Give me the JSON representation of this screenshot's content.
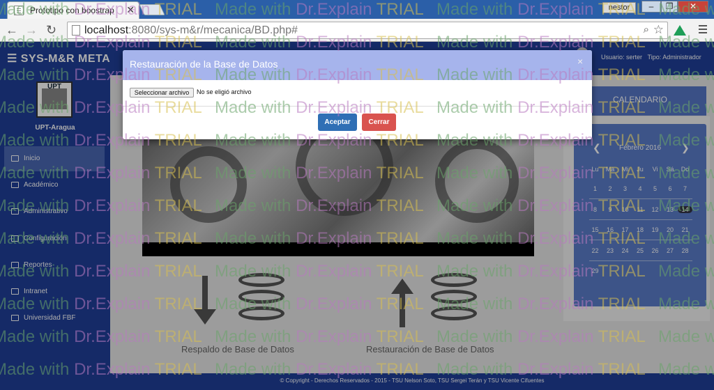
{
  "browser": {
    "tab_title": "Prototipo con boostrap",
    "tab_close": "✕",
    "profile": "nestor",
    "url_host": "localhost",
    "url_path": ":8080/sys-m&r/mecanica/BD.php#",
    "window_min": "–",
    "window_max": "❐",
    "window_close": "✕"
  },
  "app": {
    "brand": "☰  SYS-M&R  META",
    "user_label": "Usuario: serter",
    "role_label": "Tipo: Administrador",
    "logo_text": "UPT",
    "institution": "UPT-Aragua"
  },
  "sidebar": {
    "items": [
      {
        "label": "Inicio",
        "icon": "folder-open-icon"
      },
      {
        "label": "Académico",
        "icon": "book-icon"
      },
      {
        "label": "Administrativo",
        "icon": "monitor-icon"
      },
      {
        "label": "Configuración",
        "icon": "gears-icon"
      },
      {
        "label": "Reportes",
        "icon": "file-icon"
      },
      {
        "label": "Intranet",
        "icon": "sitemap-icon"
      },
      {
        "label": "Universidad FBF",
        "icon": "institution-icon"
      }
    ]
  },
  "main": {
    "backup_caption": "Respaldo de Base de Datos",
    "restore_caption": "Restauración de Base de Datos"
  },
  "calendar": {
    "title": "CALENDARIO",
    "month": "Febrero 2016",
    "prev": "❮",
    "next": "❯",
    "weekdays": [
      "Lu",
      "Ma",
      "Mi",
      "Ju",
      "Vi",
      "Sá",
      "Do"
    ],
    "weeks": [
      [
        "1",
        "2",
        "3",
        "4",
        "5",
        "6",
        "7"
      ],
      [
        "8",
        "9",
        "10",
        "11",
        "12",
        "13",
        "14"
      ],
      [
        "15",
        "16",
        "17",
        "18",
        "19",
        "20",
        "21"
      ],
      [
        "22",
        "23",
        "24",
        "25",
        "26",
        "27",
        "28"
      ],
      [
        "29",
        "",
        "",
        "",
        "",
        "",
        ""
      ]
    ],
    "today": "14"
  },
  "footer": {
    "text": "© Copyright - Derechos Reservados - 2015 - TSU Nelson Soto, TSU Sergei Terán y TSU Vicente Cifuentes"
  },
  "modal": {
    "title": "Restauración de la Base de Datos",
    "close": "×",
    "file_button": "Seleccionar archivo",
    "file_status": "No se eligió archivo",
    "accept": "Aceptar",
    "cancel": "Cerrar"
  },
  "watermark": {
    "part1": "Made with ",
    "part2": "Dr.Explain ",
    "part3": "TRIAL"
  },
  "colors": {
    "navbar": "#1f3e99",
    "modal_header": "#a6b4ec",
    "accept": "#2f6fb5",
    "cancel": "#d9534f"
  }
}
